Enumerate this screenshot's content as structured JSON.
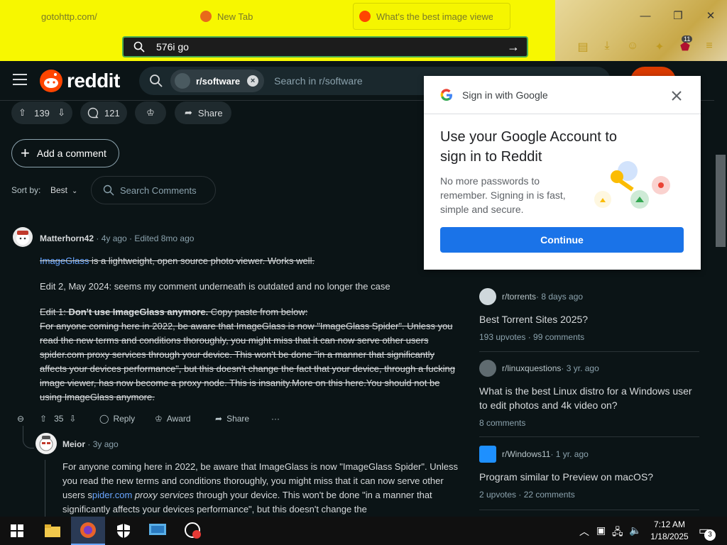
{
  "browser": {
    "tabs": [
      {
        "label": "gotohttp.com/"
      },
      {
        "label": "New Tab"
      },
      {
        "label": "What's the best image viewer fo"
      }
    ],
    "url": "576i go",
    "ext_badge": "11",
    "accent": "#f7f700"
  },
  "reddit": {
    "brand": "reddit",
    "subreddit_chip": "r/software",
    "search_placeholder": "Search in r/software",
    "post": {
      "votes": "139",
      "comments": "121",
      "share_label": "Share"
    },
    "add_comment": "Add a comment",
    "sort_label": "Sort by:",
    "sort_value": "Best",
    "search_comments": "Search Comments",
    "comment1": {
      "user": "Matterhorn42",
      "meta": "· 4y ago · Edited 8mo ago",
      "link": "ImageGlass",
      "p1_rest": " is a lightweight, open source photo viewer. Works well.",
      "p2": "Edit 2, May 2024: seems my comment underneath is outdated and no longer the case",
      "p3_prefix": "Edit 1: ",
      "p3_bold": "Don't use ImageGlass anymore.",
      "p3_suffix": " Copy paste from below:",
      "p4": "For anyone coming here in 2022, be aware that ImageGlass is now \"ImageGlass Spider\". Unless you read the new terms and conditions thoroughly, you might miss that it can now serve other users spider.com proxy services through your device. This won't be done \"in a manner that significantly affects your devices performance\", but this doesn't change the fact that your device, through a fucking image viewer, has now become a proxy node. This is insanity.More on this here.You should not be using ImageGlass anymore.",
      "votes": "35",
      "reply": "Reply",
      "award": "Award",
      "share": "Share",
      "more": "···"
    },
    "comment2": {
      "user": "Meior",
      "meta": "· 3y ago",
      "t1": "For anyone coming here in 2022, be aware that ImageGlass is now \"ImageGlass Spider\". Unless you read the new terms and conditions thoroughly, you might miss that it can now serve other users s",
      "t_link": "pider.com",
      "t_space": " ",
      "t_italic": "proxy services",
      "t2": " through your device. This won't be done \"in a manner that significantly affects your devices performance\", but this doesn't change the"
    },
    "sidebar": [
      {
        "sub": "r/torrents",
        "age": " · 8 days ago",
        "title": "Best Torrent Sites 2025?",
        "stats": "193 upvotes  ·  99 comments",
        "color": "#cfd8dc"
      },
      {
        "sub": "r/linuxquestions",
        "age": " · 3 yr. ago",
        "title": "What is the best Linux distro for a Windows user to edit photos and 4k video on?",
        "stats": "8 comments",
        "color": "#5f6b70"
      },
      {
        "sub": "r/Windows11",
        "age": " · 1 yr. ago",
        "title": "Program similar to Preview on macOS?",
        "stats": "2 upvotes  ·  22 comments",
        "color": "#1e90ff"
      }
    ]
  },
  "google_popup": {
    "header": "Sign in with Google",
    "title": "Use your Google Account to sign in to Reddit",
    "body": "No more passwords to remember. Signing in is fast, simple and secure.",
    "button": "Continue"
  },
  "taskbar": {
    "time": "7:12 AM",
    "date": "1/18/2025",
    "notifications": "3"
  }
}
